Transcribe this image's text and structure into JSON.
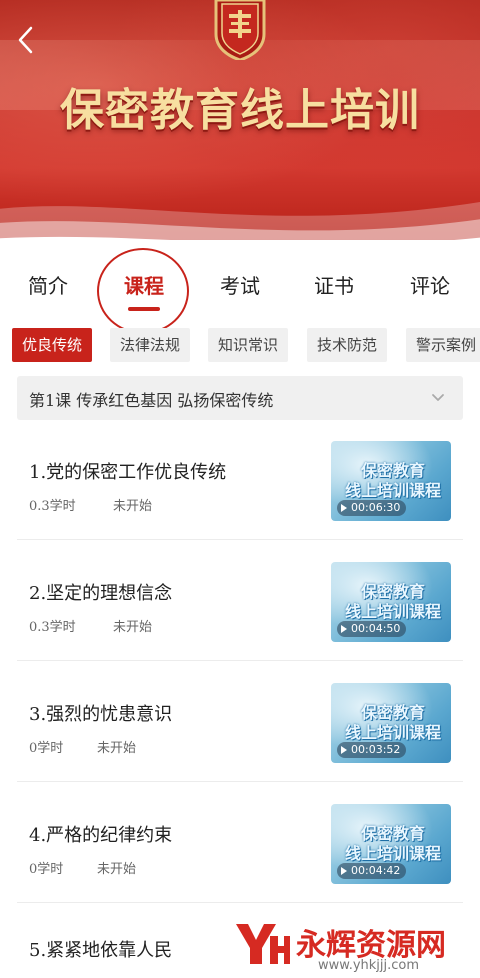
{
  "banner": {
    "title": "保密教育线上培训",
    "back_icon": "chevron-left-icon",
    "emblem_icon": "emblem-icon"
  },
  "main_tabs": [
    {
      "label": "简介"
    },
    {
      "label": "课程",
      "active": true
    },
    {
      "label": "考试"
    },
    {
      "label": "证书"
    },
    {
      "label": "评论"
    }
  ],
  "sub_tabs": [
    {
      "label": "优良传统",
      "active": true
    },
    {
      "label": "法律法规"
    },
    {
      "label": "知识常识"
    },
    {
      "label": "技术防范"
    },
    {
      "label": "警示案例"
    }
  ],
  "lesson": {
    "title": "第1课  传承红色基因  弘扬保密传统",
    "expand_icon": "chevron-down-icon"
  },
  "courses": [
    {
      "title": "1.党的保密工作优良传统",
      "hours": "0.3学时",
      "status": "未开始",
      "duration": "00:06:30"
    },
    {
      "title": "2.坚定的理想信念",
      "hours": "0.3学时",
      "status": "未开始",
      "duration": "00:04:50"
    },
    {
      "title": "3.强烈的忧患意识",
      "hours": "0学时",
      "status": "未开始",
      "duration": "00:03:52"
    },
    {
      "title": "4.严格的纪律约束",
      "hours": "0学时",
      "status": "未开始",
      "duration": "00:04:42"
    },
    {
      "title": "5.紧紧地依靠人民"
    }
  ],
  "thumbnail": {
    "line1": "保密教育",
    "line2": "线上培训课程"
  },
  "watermark": {
    "text": "永辉资源网",
    "url": "www.yhkjjj.com"
  },
  "colors": {
    "accent": "#c8231b",
    "banner_gold": "#f7dfa0"
  }
}
